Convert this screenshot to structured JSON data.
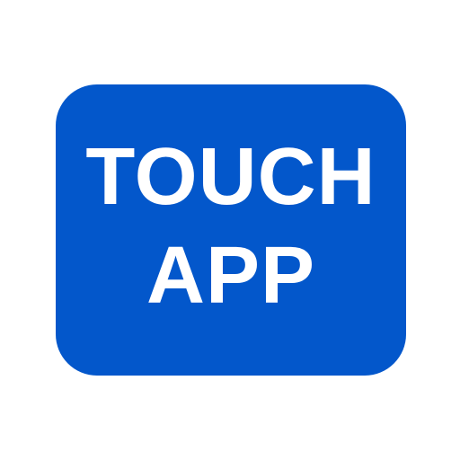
{
  "app_icon": {
    "label_line_1": "TOUCH",
    "label_line_2": "APP",
    "background_color": "#0357CB",
    "text_color": "#FFFFFF"
  },
  "page": {
    "background_color": "#FFFFFF"
  }
}
